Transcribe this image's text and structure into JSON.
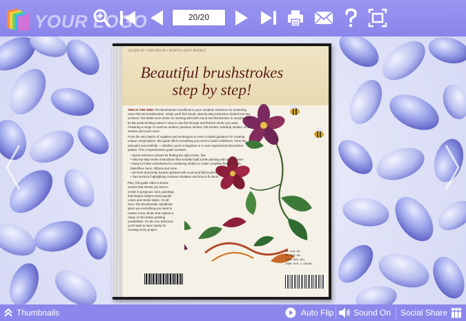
{
  "toolbar": {
    "logo_text": "YOUR LOGO",
    "page_indicator": "20/20",
    "icons": [
      "zoom-in-icon",
      "first-page-icon",
      "previous-page-icon",
      "next-page-icon",
      "last-page-icon",
      "print-icon",
      "email-icon",
      "help-icon",
      "fullscreen-icon"
    ]
  },
  "book": {
    "cover_title_line1": "Beautiful brushstrokes",
    "cover_title_line2": "step by step!",
    "cover_intro_lead": "THIS IS THE ONE!",
    "cover_intro": "The Brushstroke Handbook is your complete reference for mastering more than 50 brushstrokes. Inside you'll find visual, step-by-step instruction divided into two sections: first detail each stroke for working with both round and flat brushes in acrylics. The by flat spiral binding makes it easy to use flat through and find the stroke you want. Featuring a range of common strokes, pressure strokes, flat strokes, teardrop strokes, scroll strokes and much more.",
    "cover_intro2": "From the very basics of supplies and techniques to more in-depth guidance for creating unique compositions, this guide offers everything you need to build confidence, hone fun and paint successfully — whether you're a beginner or a more experienced decorative painter. This comprehensive guide includes:",
    "cover_bullets": [
      "Quick-reference photos for finding the right stroke, fast",
      "Step-by-step stroke instructions that actually build a little painting with every lesson",
      "Easy-to-follow worksheets for combining strokes to make complete flowers, birds, butterflies, bees, ribbons and more",
      "20 fresh and pretty borders painted with round and flat brushes",
      "Two sections highlighting common mistakes and how to fix them"
    ],
    "cover_outro": "Plus, this guide offers a bonus section that shows you how to create in gorgeous color, paintings that feature today's most popular colors and stroke styles. It's all here! The Brushstroke Handbook gives you everything you need to master every stroke and explore a range of decorative painting possibilities. It's the one reference you'll want to have handy for creating every project.",
    "cover_price_lines": [
      "UK £16.99",
      "US $22.99",
      "(CAN $25.99)",
      "ISBN 978-1-58180-"
    ],
    "cover_topline": "US $22.99 • CAN $25.99 • NORTH LIGHT BOOKS"
  },
  "bottombar": {
    "thumbnails_label": "Thumbnails",
    "autoflip_label": "Auto Flip",
    "sound_label": "Sound On",
    "social_label": "Social Share"
  },
  "colors": {
    "toolbar_bg": "#9a95f2",
    "bottombar_bg": "#8c87ec",
    "icon": "#ffffff",
    "title_red": "#5a1f1a"
  }
}
